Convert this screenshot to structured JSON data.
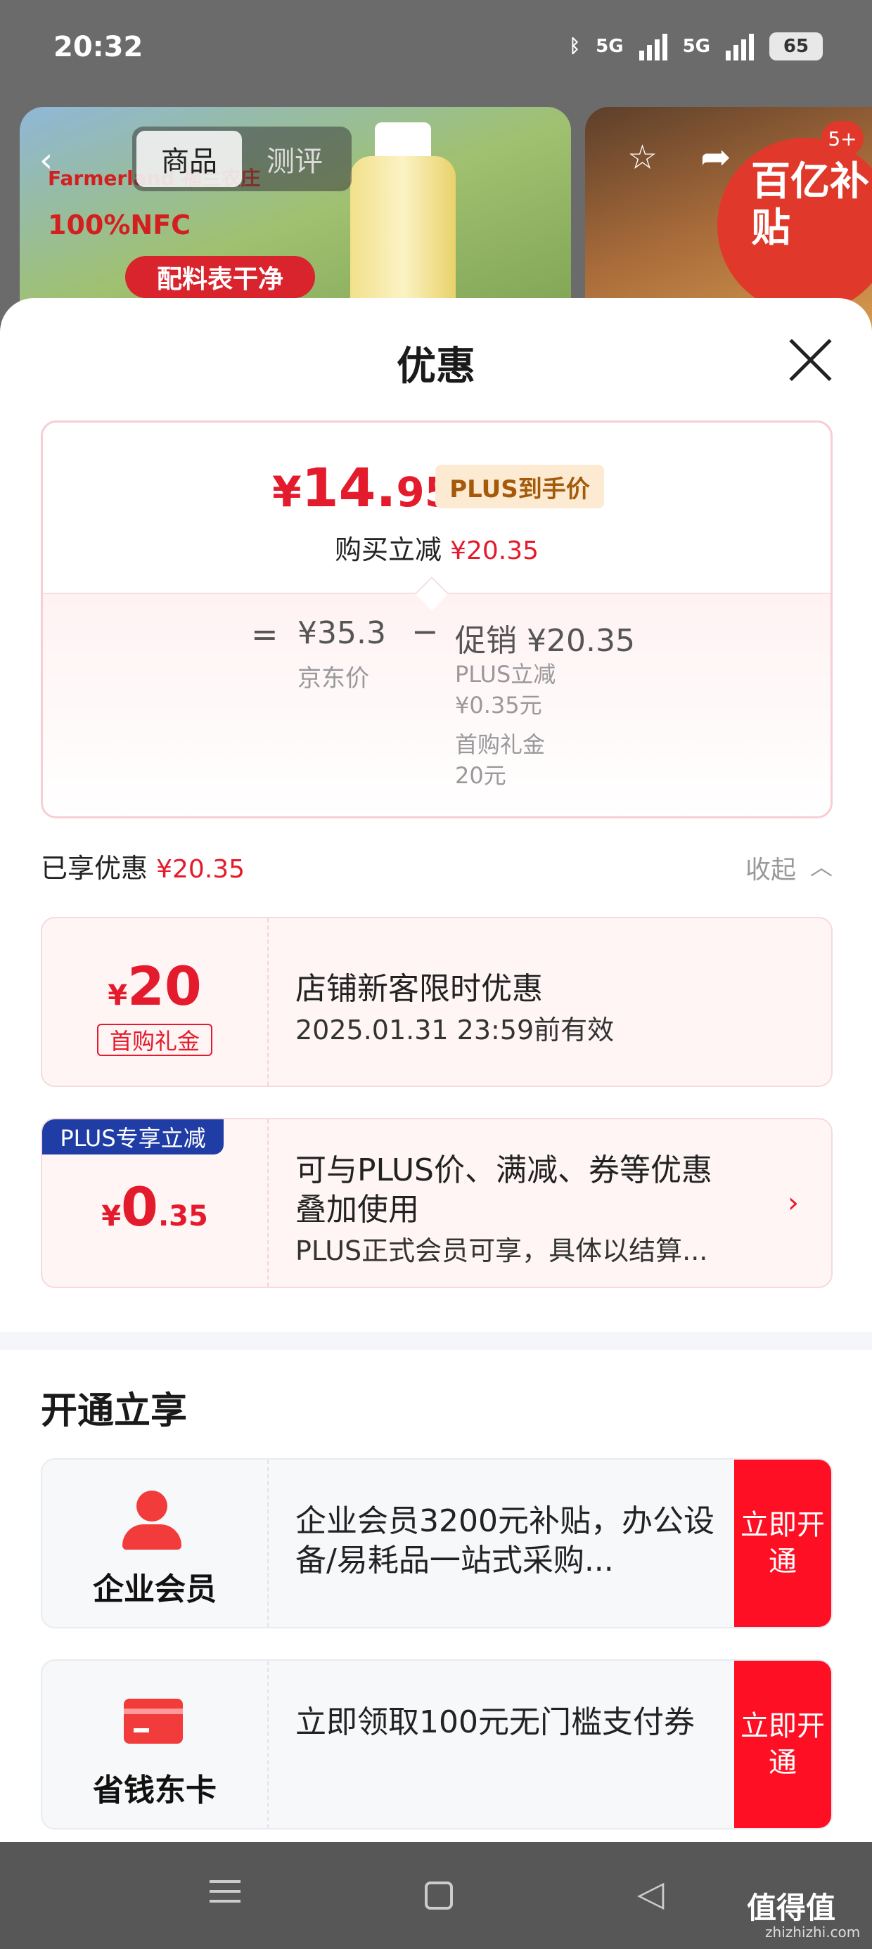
{
  "status_bar": {
    "time": "20:32",
    "network1": "5G",
    "network2": "5G",
    "battery": "65"
  },
  "background": {
    "tabs": [
      "商品",
      "测评"
    ],
    "brand": "Farmerland 福兰农庄",
    "nfc": "100%NFC",
    "pill": "配料表干净",
    "subsidy": "百亿补贴",
    "badge": "5+"
  },
  "sheet": {
    "title": "优惠",
    "price": {
      "yen": "¥",
      "int": "14.",
      "dec": "95"
    },
    "plus_tag": "PLUS到手价",
    "buy_reduce_label": "购买立减",
    "buy_reduce_value": "¥20.35",
    "eq": "=",
    "jd_price": "¥35.3",
    "jd_label": "京东价",
    "minus": "−",
    "promo": "促销 ¥20.35",
    "promo_lines": [
      "PLUS立减",
      "¥0.35元",
      "首购礼金",
      "20元"
    ],
    "enjoyed_label": "已享优惠",
    "enjoyed_value": "¥20.35",
    "collapse": "收起"
  },
  "coupons": [
    {
      "yen": "¥",
      "amount": "20",
      "label": "首购礼金",
      "title": "店铺新客限时优惠",
      "sub": "2025.01.31 23:59前有效"
    },
    {
      "corner": "PLUS专享立减",
      "yen": "¥",
      "amount": "0",
      "dec": ".35",
      "title_line1": "可与PLUS价、满减、券等优惠",
      "title_line2": "叠加使用",
      "sub": "PLUS正式会员可享，具体以结算..."
    }
  ],
  "open_section": {
    "title": "开通立享",
    "offers": [
      {
        "name": "企业会员",
        "desc": "企业会员3200元补贴，办公设备/易耗品一站式采购...",
        "cta": "立即开通"
      },
      {
        "name": "省钱东卡",
        "desc": "立即领取100元无门槛支付券",
        "cta": "立即开通"
      }
    ]
  },
  "watermark": {
    "main": "值得值",
    "sub": "zhizhizhi.com"
  }
}
